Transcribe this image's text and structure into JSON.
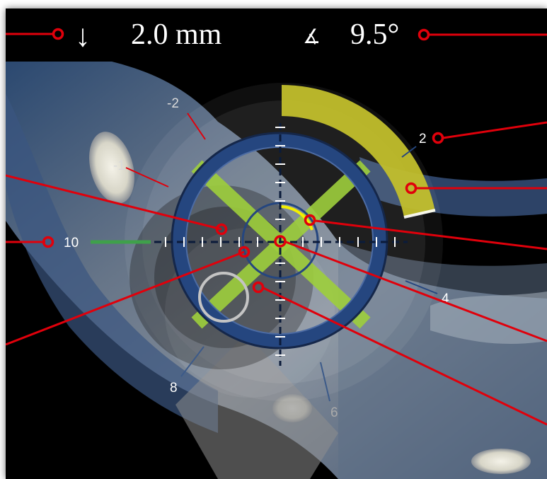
{
  "readout": {
    "depth_icon": "↓",
    "depth_value": "2.0 mm",
    "angle_icon": "∡",
    "angle_value": "9.5°"
  },
  "dial_labels": {
    "minus2": "-2",
    "minus1": "-1",
    "two": "2",
    "four": "4",
    "six": "6",
    "eight": "8",
    "ten": "10"
  },
  "icons": {
    "depth": "down-arrow-icon",
    "angle": "angle-icon",
    "crosshair": "crosshair-icon"
  },
  "colors": {
    "background": "#000000",
    "callout_red": "#e0000b",
    "dial_blue": "#25467f",
    "guide_green": "#9ecf3c",
    "depth_bar_green": "#3fa04b",
    "angle_arc_yellow": "#c2bf2c",
    "angle_marker_yellow": "#f4f000"
  }
}
